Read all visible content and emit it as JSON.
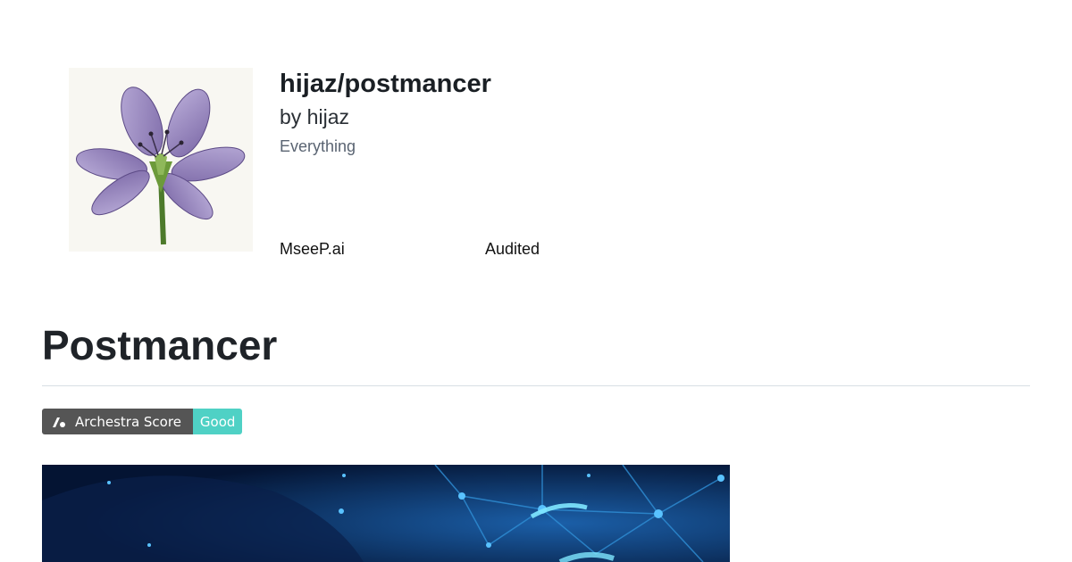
{
  "header": {
    "title": "hijaz/postmancer",
    "author": "by hijaz",
    "category": "Everything",
    "badges": [
      "MseeP.ai",
      "Audited"
    ]
  },
  "main": {
    "title": "Postmancer"
  },
  "score_badge": {
    "label": "Archestra Score",
    "value": "Good",
    "value_color": "#4fd1c5"
  },
  "icons": {
    "logo": "purple-flower-logo",
    "archestra": "archestra-logo-icon"
  }
}
